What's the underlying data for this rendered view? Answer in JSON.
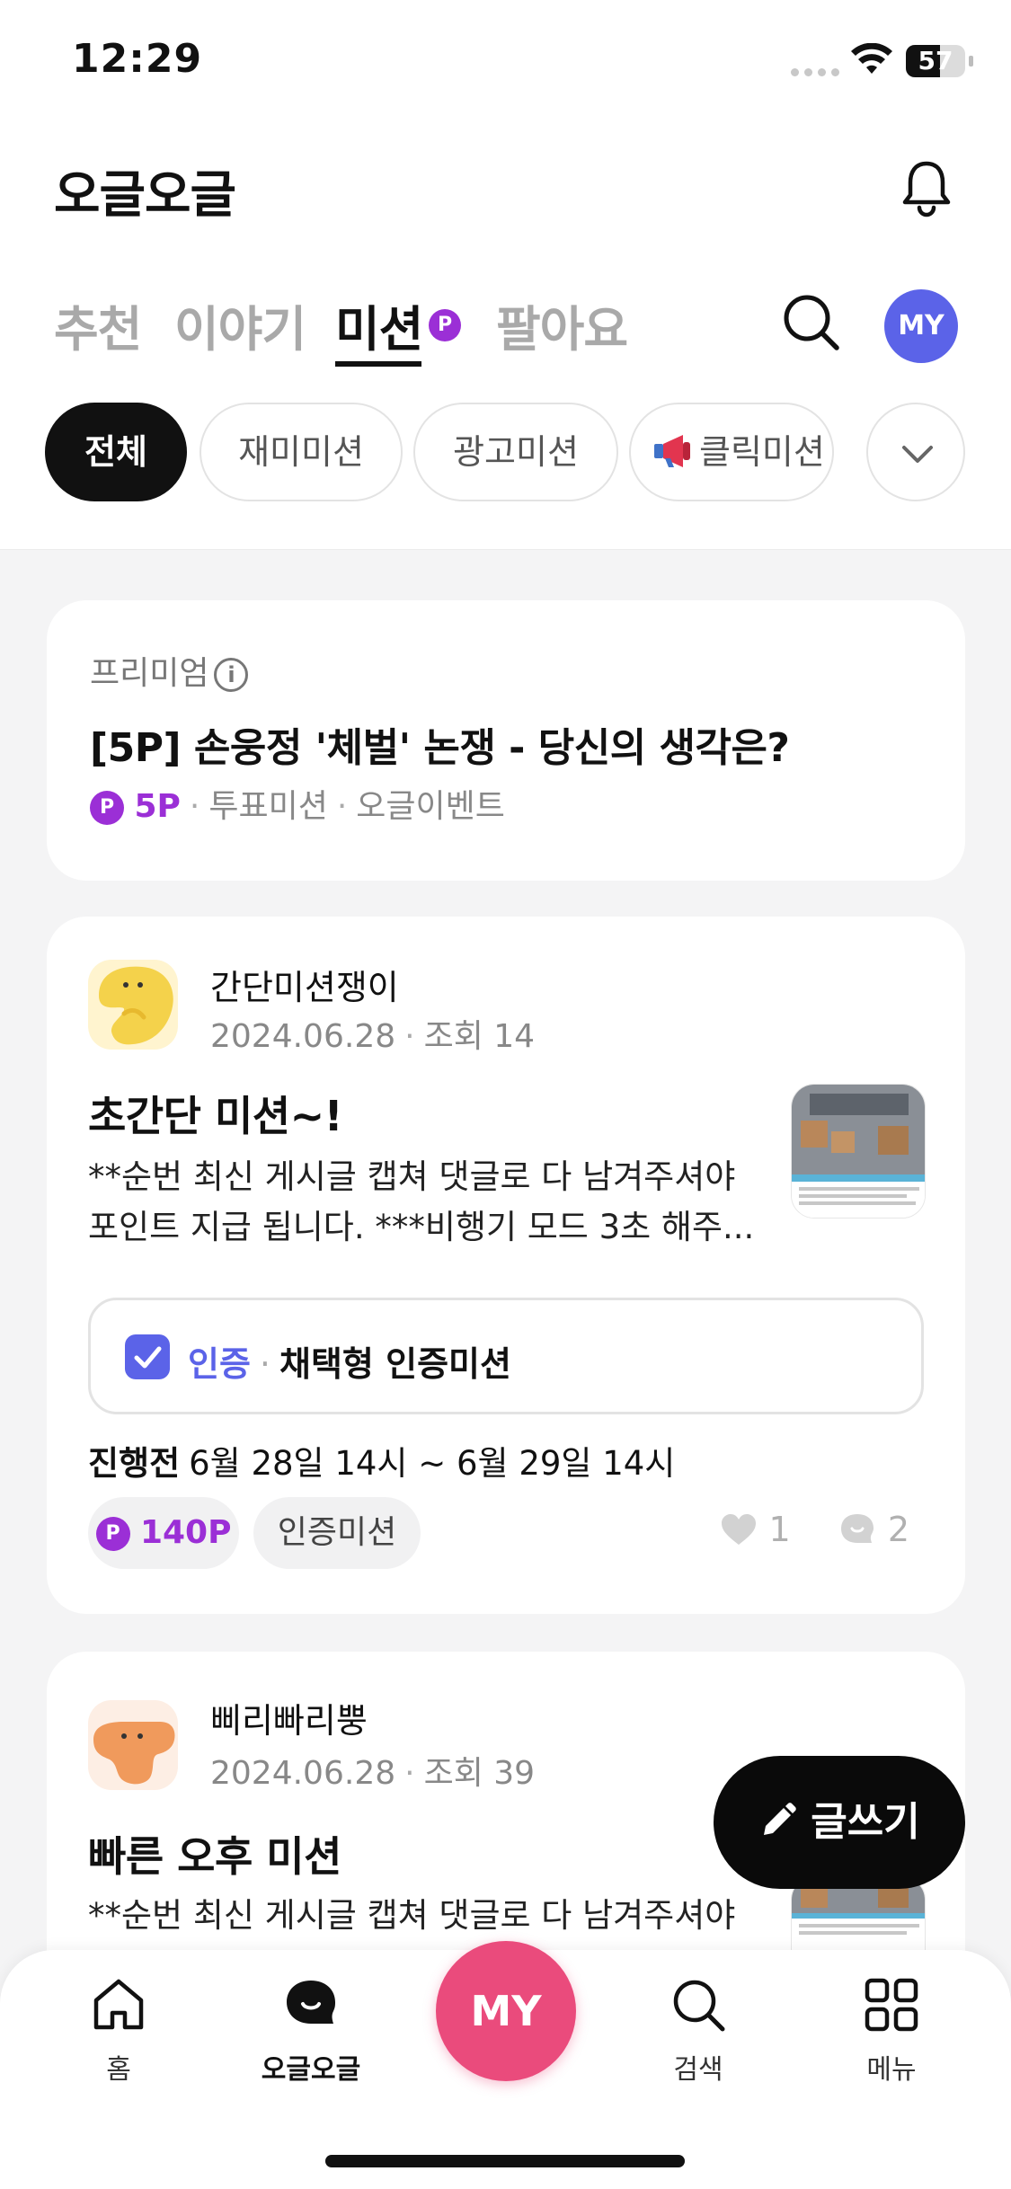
{
  "status": {
    "time": "12:29",
    "battery": "57",
    "battery_level": 0.57
  },
  "header": {
    "title": "오글오글"
  },
  "tabs": [
    {
      "label": "추천"
    },
    {
      "label": "이야기"
    },
    {
      "label": "미션",
      "badge": "P"
    },
    {
      "label": "팔아요"
    }
  ],
  "my_avatar": "MY",
  "chips": [
    {
      "label": "전체"
    },
    {
      "label": "재미미션"
    },
    {
      "label": "광고미션"
    },
    {
      "label": "클릭미션",
      "icon": "megaphone-icon"
    }
  ],
  "premium": {
    "label": "프리미엄",
    "info": "i",
    "title": "[5P] 손웅정 '체벌' 논쟁 - 당신의 생각은?",
    "badge": "P",
    "points": "5P",
    "tag1": "투표미션",
    "tag2": "오글이벤트",
    "sep": "·"
  },
  "posts": [
    {
      "author": "간단미션쟁이",
      "date": "2024.06.28",
      "views": "조회 14",
      "sep": "·",
      "title": "초간단 미션~!",
      "body": "**순번 최신 게시글 캡쳐 댓글로 다 남겨주셔야 포인트 지급 됩니다. ***비행기 모드 3초 해주...",
      "verify_label": "인증",
      "verify_type": "채택형 인증미션",
      "period_status": "진행전",
      "period": "6월 28일 14시 ~ 6월 29일 14시",
      "points": "140P",
      "badge": "P",
      "category": "인증미션",
      "likes": "1",
      "comments": "2"
    },
    {
      "author": "삐리빠리뿡",
      "date": "2024.06.28",
      "views": "조회 39",
      "sep": "·",
      "title": "빠른 오후 미션",
      "body": "**순번 최신 게시글 캡쳐 댓글로 다 남겨주셔야"
    }
  ],
  "write_button": "글쓰기",
  "bottom_nav": [
    {
      "label": "홈",
      "icon": "home-icon"
    },
    {
      "label": "오글오글",
      "icon": "chat-bubble-icon",
      "active": true
    },
    {
      "label": "MY",
      "icon": "my-center"
    },
    {
      "label": "검색",
      "icon": "search-icon"
    },
    {
      "label": "메뉴",
      "icon": "grid-icon"
    }
  ],
  "colors": {
    "accent_purple": "#9b2fd6",
    "accent_blue": "#5b63e8",
    "my_pink": "#ea4b7c"
  }
}
